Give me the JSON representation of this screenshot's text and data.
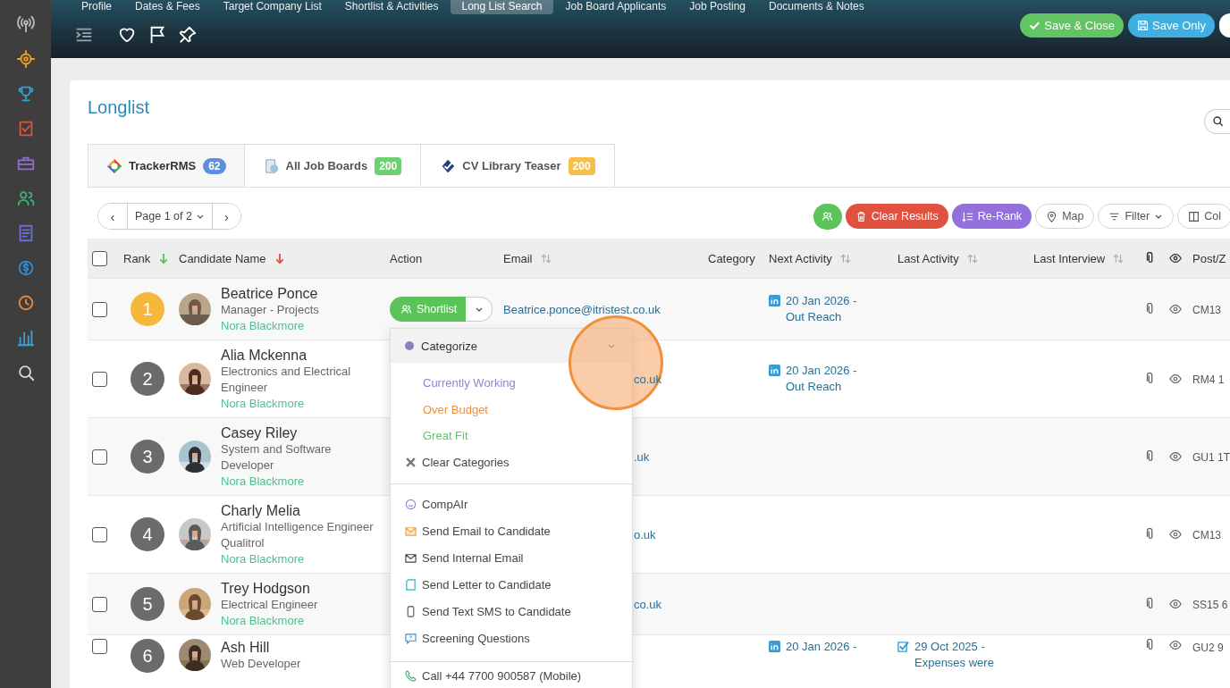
{
  "top_tabs": [
    {
      "label": "Profile",
      "selected": false
    },
    {
      "label": "Dates & Fees",
      "selected": false
    },
    {
      "label": "Target Company List",
      "selected": false
    },
    {
      "label": "Shortlist & Activities",
      "selected": false
    },
    {
      "label": "Long List Search",
      "selected": true
    },
    {
      "label": "Job Board Applicants",
      "selected": false
    },
    {
      "label": "Job Posting",
      "selected": false
    },
    {
      "label": "Documents & Notes",
      "selected": false
    }
  ],
  "header_buttons": [
    {
      "kind": "close",
      "label": "Save & Close",
      "color": "#62c462"
    },
    {
      "kind": "save",
      "label": "Save Only",
      "color": "#3faee0"
    }
  ],
  "page": {
    "title": "Longlist"
  },
  "source_tabs": [
    {
      "label": "TrackerRMS",
      "count": "62",
      "color": "#5b8fdc",
      "selected": true
    },
    {
      "label": "All Job Boards",
      "count": "200",
      "color": "#6fcf73",
      "selected": false
    },
    {
      "label": "CV Library Teaser",
      "count": "200",
      "color": "#f5c04a",
      "selected": false
    }
  ],
  "pager": {
    "prev": "‹",
    "label": "Page 1 of 2",
    "next": "›"
  },
  "actions": [
    {
      "kind": "icon",
      "color": "#5cc35a"
    },
    {
      "kind": "solid",
      "label": "Clear Results",
      "color": "#e0523f"
    },
    {
      "kind": "solid",
      "label": "Re-Rank",
      "color": "#9370db"
    },
    {
      "kind": "outline",
      "label": "Map"
    },
    {
      "kind": "outline",
      "label": "Filter"
    },
    {
      "kind": "outline",
      "label": "Col"
    }
  ],
  "table": {
    "select_all": {
      "checked": false
    },
    "columns": [
      {
        "label": "Rank",
        "sorted": true,
        "sortable": true,
        "color": "#5cc35a"
      },
      {
        "label": "Candidate Name",
        "sorted": true,
        "sortable": true,
        "color": "#e0523f"
      },
      {
        "label": "Action"
      },
      {
        "label": "Email",
        "sorted": false,
        "sortable": true
      },
      {
        "label": "Category"
      },
      {
        "label": "Next Activity",
        "sorted": false,
        "sortable": true
      },
      {
        "label": "Last Activity",
        "sorted": false,
        "sortable": true
      },
      {
        "label": "Last Interview",
        "sorted": false,
        "sortable": true
      },
      {
        "label": "Post/Z"
      }
    ],
    "rows": [
      {
        "checked": false,
        "rank": "1",
        "color": "#f6b73c",
        "name": "Beatrice Ponce",
        "title": "Manager - Projects",
        "owner": "Nora Blackmore",
        "shortlist": "Shortlist",
        "email": "Beatrice.ponce@itristest.co.uk",
        "next_activity": "20 Jan 2026 - Out Reach",
        "post": "CM13"
      },
      {
        "checked": false,
        "rank": "2",
        "color": "#6b6b6b",
        "name": "Alia Mckenna",
        "title": "Electronics and Electrical Engineer",
        "owner": "Nora Blackmore",
        "email": "co.uk",
        "next_activity": "20 Jan 2026 - Out Reach",
        "post": "RM4 1"
      },
      {
        "checked": false,
        "rank": "3",
        "color": "#6b6b6b",
        "name": "Casey Riley",
        "title": "System and Software Developer",
        "owner": "Nora Blackmore",
        "email": ".uk",
        "post": "GU1 1T"
      },
      {
        "checked": false,
        "rank": "4",
        "color": "#6b6b6b",
        "name": "Charly Melia",
        "title": "Artificial Intelligence Engineer Qualitrol",
        "owner": "Nora Blackmore",
        "email": "o.uk",
        "post": "CM13"
      },
      {
        "checked": false,
        "rank": "5",
        "color": "#6b6b6b",
        "name": "Trey Hodgson",
        "title": "Electrical Engineer",
        "owner": "Nora Blackmore",
        "email": "co.uk",
        "post": "SS15 6"
      },
      {
        "checked": false,
        "rank": "6",
        "color": "#6b6b6b",
        "name": "Ash Hill",
        "title": "Web Developer",
        "next_activity": "20 Jan 2026 -",
        "last_activity": "29 Oct 2025 - Expenses were",
        "post": "GU2 9"
      }
    ]
  },
  "menu": {
    "title": "Categorize",
    "categories": [
      {
        "label": "Currently Working",
        "color": "#9b7fd0"
      },
      {
        "label": "Over Budget",
        "color": "#f0903a"
      },
      {
        "label": "Great Fit",
        "color": "#62c46a"
      }
    ],
    "clear": "Clear Categories",
    "actions": [
      "CompAIr",
      "Send Email to Candidate",
      "Send Internal Email",
      "Send Letter to Candidate",
      "Send Text SMS to Candidate",
      "Screening Questions"
    ],
    "call": "Call +44 7700 900587 (Mobile)"
  }
}
